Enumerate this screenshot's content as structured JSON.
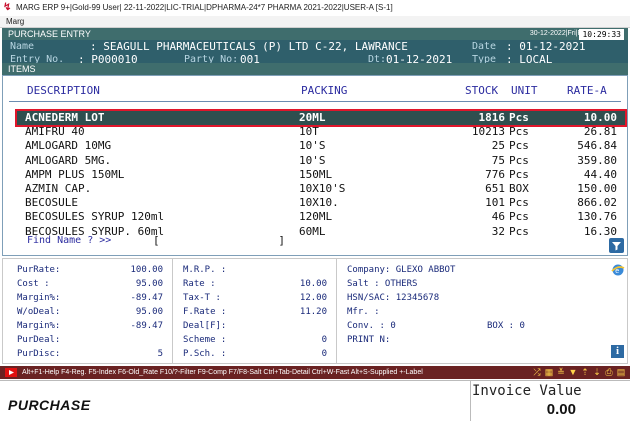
{
  "window": {
    "title": "MARG ERP 9+|Gold-99 User| 22-11-2022|LIC-TRIAL|DPHARMA-24*7 PHARMA 2021-2022|USER-A [S-1]",
    "menu_label": "Marg"
  },
  "header": {
    "title": "PURCHASE ENTRY",
    "date_day": "30-12-2022|Fri|P|",
    "time": "10:29:33"
  },
  "entry": {
    "name_label": "Name",
    "name_value": ": SEAGULL PHARMACEUTICALS (P) LTD C-22, LAWRANCE",
    "date_label": "Date",
    "date_value": ": 01-12-2021",
    "entry_no_label": "Entry No.",
    "entry_no_value": ": P000010",
    "party_no_label": "Party No:",
    "party_no_value": "001",
    "dt_label": "Dt:",
    "dt_value": "01-12-2021",
    "type_label": "Type",
    "type_value": ": LOCAL"
  },
  "items_bar": {
    "label": "ITEMS"
  },
  "grid": {
    "columns": {
      "description": "DESCRIPTION",
      "packing": "PACKING",
      "stock": "STOCK",
      "unit": "UNIT",
      "rate": "RATE-A"
    },
    "rows": [
      {
        "description": "ACNEDERM LOT",
        "packing": "20ML",
        "stock": "1816",
        "unit": "Pcs",
        "rate": "10.00"
      },
      {
        "description": "AMIFRU 40",
        "packing": "10T",
        "stock": "10213",
        "unit": "Pcs",
        "rate": "26.81"
      },
      {
        "description": "AMLOGARD 10MG",
        "packing": "10'S",
        "stock": "25",
        "unit": "Pcs",
        "rate": "546.84"
      },
      {
        "description": "AMLOGARD 5MG.",
        "packing": "10'S",
        "stock": "75",
        "unit": "Pcs",
        "rate": "359.80"
      },
      {
        "description": "AMPM PLUS 150ML",
        "packing": "150ML",
        "stock": "776",
        "unit": "Pcs",
        "rate": "44.40"
      },
      {
        "description": "AZMIN CAP.",
        "packing": "10X10'S",
        "stock": "651",
        "unit": "BOX",
        "rate": "150.00"
      },
      {
        "description": "BECOSULE",
        "packing": "10X10.",
        "stock": "101",
        "unit": "Pcs",
        "rate": "866.02"
      },
      {
        "description": "BECOSULES SYRUP 120ml",
        "packing": "120ML",
        "stock": "46",
        "unit": "Pcs",
        "rate": "130.76"
      },
      {
        "description": "BECOSULES SYRUP. 60ml",
        "packing": "60ML",
        "stock": "32",
        "unit": "Pcs",
        "rate": "16.30"
      }
    ],
    "find_label": "Find Name ? >>",
    "find_open": "[",
    "find_close": "]",
    "filter_icon": "funnel-icon"
  },
  "details": {
    "left": [
      {
        "label": "PurRate:",
        "value": "100.00"
      },
      {
        "label": "Cost    :",
        "value": "95.00"
      },
      {
        "label": "Margin%:",
        "value": "-89.47"
      },
      {
        "label": "W/oDeal:",
        "value": "95.00"
      },
      {
        "label": "Margin%:",
        "value": "-89.47"
      },
      {
        "label": "PurDeal:",
        "value": ""
      },
      {
        "label": "PurDisc:",
        "value": "5"
      }
    ],
    "mid": [
      {
        "label": "M.R.P.  :",
        "value": ""
      },
      {
        "label": "Rate    :",
        "value": "10.00"
      },
      {
        "label": "Tax-T   :",
        "value": "12.00"
      },
      {
        "label": "F.Rate  :",
        "value": "11.20"
      },
      {
        "label": "Deal[F]:",
        "value": ""
      },
      {
        "label": "Scheme  :",
        "value": "0"
      },
      {
        "label": "P.Sch.  :",
        "value": "0"
      }
    ],
    "right": {
      "company": "Company: GLEXO ABBOT",
      "salt": "Salt    : OTHERS",
      "hsn": "HSN/SAC: 12345678",
      "mfr": "Mfr.    :",
      "conv": "Conv.   : 0",
      "box": "BOX      : 0",
      "print": "PRINT N:"
    }
  },
  "status": {
    "help": "Alt+F1-Help F4-Reg. F5-Index F6-Old_Rate F10/?-Filter F9-Comp F7/F8-Salt Ctrl+Tab-Detail Ctrl+W-Fast Alt+S-Supplied +-Label"
  },
  "footer": {
    "mode": "PURCHASE",
    "invoice_label": "Invoice Value",
    "invoice_value": "0.00"
  },
  "colors": {
    "header_bg": "#3f6d6d",
    "entry_bg": "#2f5f6b",
    "selected_row_bg": "#2f4f4f",
    "selected_outline": "#e0162b",
    "status_bg": "#6a2222"
  }
}
